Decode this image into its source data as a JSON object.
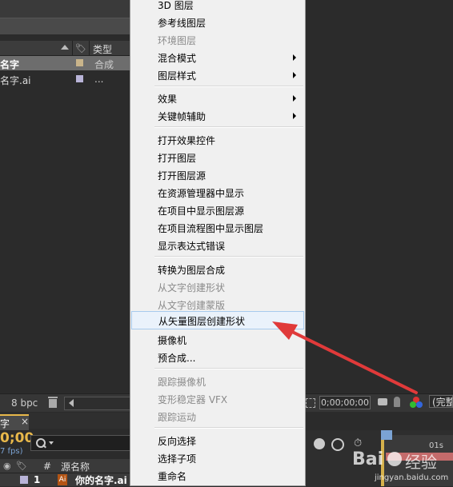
{
  "project_panel": {
    "type_column_label": "类型",
    "rows": [
      {
        "name": "名字",
        "type": "合成"
      },
      {
        "name": "名字.ai",
        "type": "..."
      }
    ],
    "bit_depth": "8 bpc"
  },
  "timeline": {
    "tab_label": "字",
    "close_glyph": "×",
    "timecode": "0;00",
    "fps": "7 fps)",
    "search_glyph": "search",
    "col_hash": "#",
    "col_source": "源名称",
    "layer_number": "1",
    "layer_type_icon": "Ai",
    "layer_name": "你的名字.ai",
    "ruler_tick": "01s"
  },
  "comp_bottom": {
    "timecode": "0;00;00;00",
    "quality": "(完整"
  },
  "context_menu": {
    "items": [
      {
        "label": "3D 图层",
        "disabled": false,
        "submenu": false
      },
      {
        "label": "参考线图层",
        "disabled": false,
        "submenu": false
      },
      {
        "label": "环境图层",
        "disabled": true,
        "submenu": false
      },
      {
        "label": "混合模式",
        "disabled": false,
        "submenu": true
      },
      {
        "label": "图层样式",
        "disabled": false,
        "submenu": true
      },
      {
        "label": "效果",
        "disabled": false,
        "submenu": true
      },
      {
        "label": "关键帧辅助",
        "disabled": false,
        "submenu": true
      },
      {
        "label": "打开效果控件",
        "disabled": false,
        "submenu": false
      },
      {
        "label": "打开图层",
        "disabled": false,
        "submenu": false
      },
      {
        "label": "打开图层源",
        "disabled": false,
        "submenu": false
      },
      {
        "label": "在资源管理器中显示",
        "disabled": false,
        "submenu": false
      },
      {
        "label": "在项目中显示图层源",
        "disabled": false,
        "submenu": false
      },
      {
        "label": "在项目流程图中显示图层",
        "disabled": false,
        "submenu": false
      },
      {
        "label": "显示表达式错误",
        "disabled": false,
        "submenu": false
      },
      {
        "label": "转换为图层合成",
        "disabled": false,
        "submenu": false
      },
      {
        "label": "从文字创建形状",
        "disabled": true,
        "submenu": false
      },
      {
        "label": "从文字创建蒙版",
        "disabled": true,
        "submenu": false
      },
      {
        "label": "从矢量图层创建形状",
        "disabled": false,
        "submenu": false,
        "highlighted": true
      },
      {
        "label": "摄像机",
        "disabled": false,
        "submenu": true
      },
      {
        "label": "预合成...",
        "disabled": false,
        "submenu": false
      },
      {
        "label": "跟踪摄像机",
        "disabled": true,
        "submenu": false
      },
      {
        "label": "变形稳定器 VFX",
        "disabled": true,
        "submenu": false
      },
      {
        "label": "跟踪运动",
        "disabled": true,
        "submenu": false
      },
      {
        "label": "反向选择",
        "disabled": false,
        "submenu": false
      },
      {
        "label": "选择子项",
        "disabled": false,
        "submenu": false
      },
      {
        "label": "重命名",
        "disabled": false,
        "submenu": false
      }
    ]
  },
  "watermark": {
    "brand": "Bai",
    "brand_cn": "经验",
    "url": "jingyan.baidu.com"
  },
  "colors": {
    "menu_bg": "#f0f0f0",
    "highlight_bg": "#eaf2fb",
    "highlight_border": "#a8cbed",
    "annotation_arrow": "#e03a3a",
    "timecode_yellow": "#e8b84a"
  }
}
